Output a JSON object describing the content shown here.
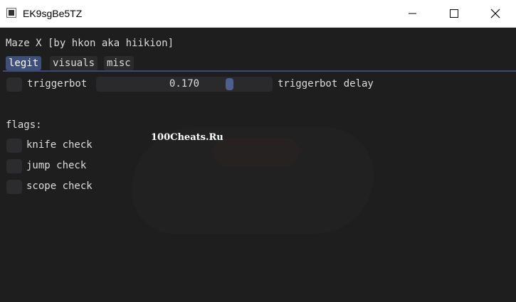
{
  "window": {
    "title": "EK9sgBe5TZ"
  },
  "menu": {
    "title": "Maze X [by hkon aka hiikion]",
    "tabs": [
      {
        "label": "legit",
        "active": true
      },
      {
        "label": "visuals",
        "active": false
      },
      {
        "label": "misc",
        "active": false
      }
    ],
    "triggerbot": {
      "checkbox_label": "triggerbot",
      "checked": false,
      "delay_value": "0.170",
      "delay_label": "triggerbot delay"
    },
    "flags": {
      "heading": "flags:",
      "items": [
        {
          "label": "knife check",
          "checked": false
        },
        {
          "label": "jump check",
          "checked": false
        },
        {
          "label": "scope check",
          "checked": false
        }
      ]
    }
  },
  "watermark": {
    "text": "100Cheats.Ru"
  },
  "colors": {
    "background": "#1e1e1f",
    "accent": "#3f4f7b",
    "slider_grab": "#4d5f91",
    "frame": "#2c2c2e"
  },
  "icons": {
    "minimize": "minimize-icon",
    "maximize": "maximize-icon",
    "close": "close-icon"
  }
}
